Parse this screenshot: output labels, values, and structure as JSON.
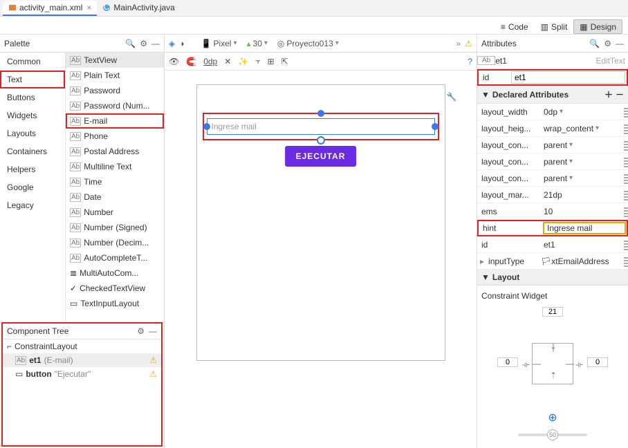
{
  "tabs": {
    "active": "activity_main.xml",
    "other": "MainActivity.java"
  },
  "view_modes": {
    "code": "Code",
    "split": "Split",
    "design": "Design"
  },
  "palette": {
    "title": "Palette",
    "categories": [
      "Common",
      "Text",
      "Buttons",
      "Widgets",
      "Layouts",
      "Containers",
      "Helpers",
      "Google",
      "Legacy"
    ],
    "header_item": "TextView",
    "items": [
      "Plain Text",
      "Password",
      "Password (Num...",
      "E-mail",
      "Phone",
      "Postal Address",
      "Multiline Text",
      "Time",
      "Date",
      "Number",
      "Number (Signed)",
      "Number (Decim...",
      "AutoCompleteT...",
      "MultiAutoCom...",
      "CheckedTextView",
      "TextInputLayout"
    ],
    "selected_item": "E-mail"
  },
  "component_tree": {
    "title": "Component Tree",
    "root": "ConstraintLayout",
    "child1_id": "et1",
    "child1_type": "(E-mail)",
    "child2_id": "button",
    "child2_text": "\"Ejecutar\""
  },
  "designer": {
    "device": "Pixel",
    "api": "30",
    "project": "Proyecto013",
    "zero_dp": "0dp",
    "hint_text": "Ingrese mail",
    "button_text": "EJECUTAR"
  },
  "attributes": {
    "title": "Attributes",
    "component_id": "et1",
    "component_type": "EditText",
    "id_label": "id",
    "id_value": "et1",
    "declared_header": "Declared Attributes",
    "rows": [
      {
        "k": "layout_width",
        "v": "0dp"
      },
      {
        "k": "layout_heig...",
        "v": "wrap_content"
      },
      {
        "k": "layout_con...",
        "v": "parent"
      },
      {
        "k": "layout_con...",
        "v": "parent"
      },
      {
        "k": "layout_con...",
        "v": "parent"
      },
      {
        "k": "layout_mar...",
        "v": "21dp"
      },
      {
        "k": "ems",
        "v": "10"
      },
      {
        "k": "hint",
        "v": "Ingrese mail"
      },
      {
        "k": "id",
        "v": "et1"
      },
      {
        "k": "inputType",
        "v": "xtEmailAddress"
      }
    ],
    "layout_header": "Layout",
    "constraint_label": "Constraint Widget",
    "top_margin": "21",
    "left_margin": "0",
    "right_margin": "0",
    "slider": "50"
  }
}
